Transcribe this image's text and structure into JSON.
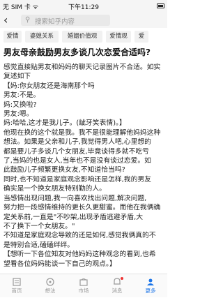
{
  "status_bar": {
    "carrier": "无 SIM 卡 ᯤ",
    "time": "下午11:29"
  },
  "search": {
    "placeholder": "搜索知乎内容"
  },
  "tags": [
    "爱情",
    "婆媳关系",
    "婚姻价值观",
    "爱情观",
    "爱"
  ],
  "article": {
    "title": "男友母亲鼓励男友多谈几次恋爱合适吗?",
    "lines": [
      "感觉直接贴男友和妈妈的聊天记录图片不合适。如实",
      "复述如下",
      "【妈:你女朋友还是海南那个吗",
      "男友:不是。",
      "妈:又换啦?",
      "男友:嗯。",
      "妈:哈哈,这才是我儿子。(龇牙笑表情)。】",
      "他现在换的这个就是我。我不是很能理解他妈妈这种",
      "想法。如果是父亲和儿子,我觉得男人吧,心里想的",
      "都是要儿子多谈几个女朋友,毕竟谈得多就不吃亏",
      "了,当妈的也是女人,当年也不是没有谈过恋爱。如",
      "此鼓励儿子频繁更换女友,不知道恰当吗?",
      "同时,也不知道是家庭观念影响还是怎样,我的男友",
      "确实是一个换女朋友特别勤的人。",
      "当感情出现问题,我一向喜欢找出问题,解决问题,",
      "努力把一段感情维持的更长久更甜蜜。而他在我俩确",
      "定关系前,一直是\"不吵架,出现矛盾逃避矛盾,大",
      "不了换下一个女朋友。\"",
      "不知道是家庭观念导致的还是如何,感觉我俩真的不",
      "是特别合适,磕磕绊绊。",
      "【想听一下各位知友对他妈妈这种观念的看到,也希",
      "望看各位妈妈能谈一下自己的观点。】"
    ]
  },
  "tabbar": {
    "items": [
      {
        "label": "首页",
        "icon": "home-icon"
      },
      {
        "label": "想法",
        "icon": "thoughts-icon"
      },
      {
        "label": "市场",
        "icon": "market-icon"
      },
      {
        "label": "消息",
        "icon": "bell-icon"
      },
      {
        "label": "更多",
        "icon": "more-icon"
      }
    ],
    "active": 4
  },
  "colors": {
    "accent": "#1a74e8",
    "notify": "#e33333"
  }
}
